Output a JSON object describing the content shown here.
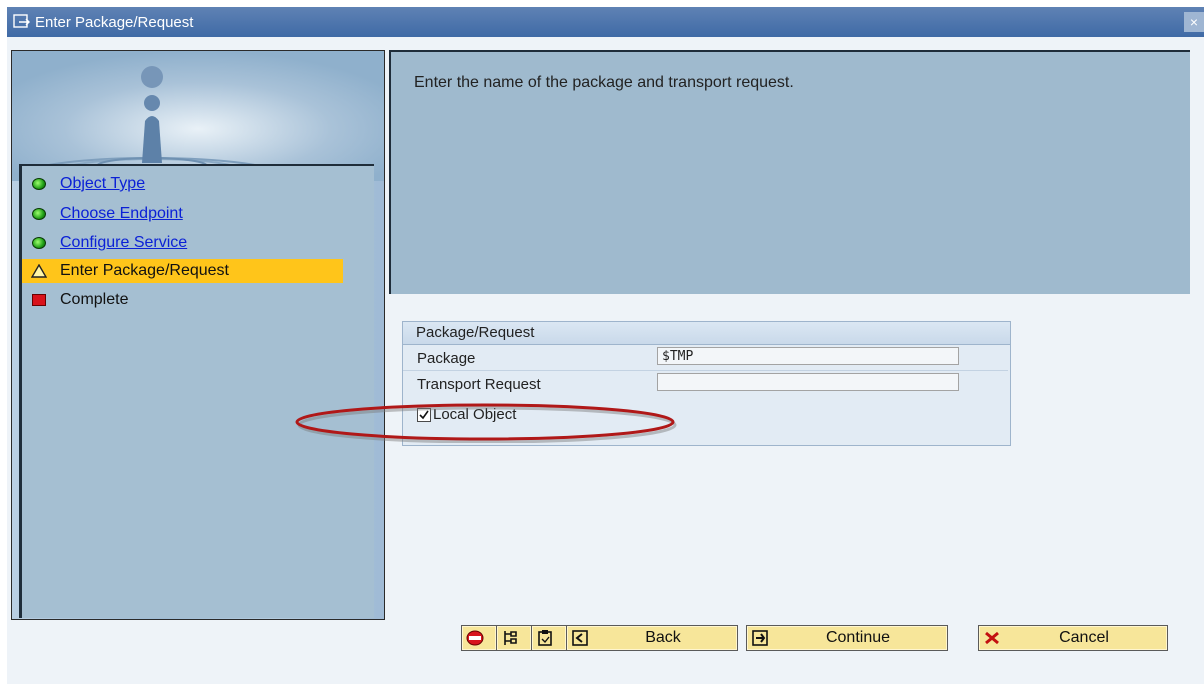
{
  "window": {
    "title": "Enter Package/Request",
    "close_symbol": "×"
  },
  "wizard": {
    "steps": [
      {
        "label": "Object Type",
        "state": "done"
      },
      {
        "label": "Choose Endpoint",
        "state": "done"
      },
      {
        "label": "Configure Service",
        "state": "done"
      },
      {
        "label": "Enter Package/Request",
        "state": "current"
      },
      {
        "label": "Complete",
        "state": "pending"
      }
    ]
  },
  "info": {
    "message": "Enter the name of the package and transport request."
  },
  "group": {
    "title": "Package/Request",
    "package_label": "Package",
    "package_value": "$TMP",
    "transport_label": "Transport Request",
    "transport_value": "",
    "local_object_label": "Local Object",
    "local_object_checked": true
  },
  "footer": {
    "back_label": "Back",
    "continue_label": "Continue",
    "cancel_label": "Cancel"
  },
  "colors": {
    "active_step": "#ffc51a",
    "link": "#0b21d6",
    "button": "#f7e69a",
    "highlight_ellipse": "#b01818"
  }
}
